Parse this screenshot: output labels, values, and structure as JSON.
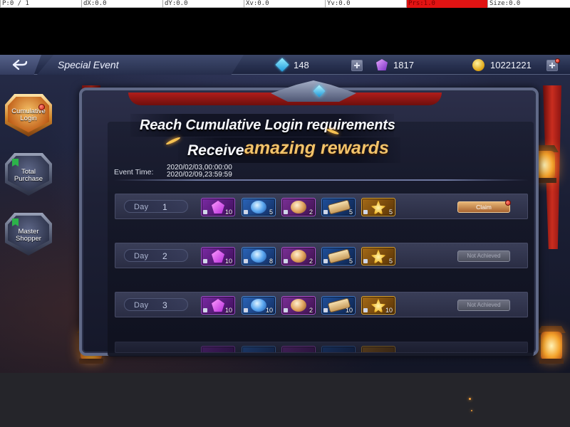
{
  "debug_bar": {
    "cells": [
      {
        "text": "P:0 / 1",
        "hot": false
      },
      {
        "text": "dX:0.0",
        "hot": false
      },
      {
        "text": "dY:0.0",
        "hot": false
      },
      {
        "text": "Xv:0.0",
        "hot": false
      },
      {
        "text": "Yv:0.0",
        "hot": false
      },
      {
        "text": "Prs:1.0",
        "hot": true
      },
      {
        "text": "Size:0.0",
        "hot": false
      }
    ]
  },
  "header": {
    "title": "Special Event",
    "diamonds": "148",
    "crystals": "1817",
    "gold": "10221221"
  },
  "tabs": [
    {
      "label": "Cumulative Login",
      "active": true,
      "badge": true
    },
    {
      "label": "Total Purchase",
      "active": false,
      "badge": false
    },
    {
      "label": "Master Shopper",
      "active": false,
      "badge": false
    }
  ],
  "banner": {
    "headline": "Reach Cumulative Login requirements",
    "subline_prefix": "Receive",
    "subline_highlight": "amazing rewards"
  },
  "event_time": {
    "label": "Event Time:",
    "start": "2020/02/03,00:00:00",
    "end": "2020/02/09,23:59:59"
  },
  "days": [
    {
      "label": "Day",
      "num": "1",
      "status": "Claim",
      "claimable": true,
      "rewards": [
        {
          "icon": "purple-gem-icon",
          "style": "purple",
          "qty": "10"
        },
        {
          "icon": "blue-orb-icon",
          "style": "blue",
          "qty": "5"
        },
        {
          "icon": "gold-orb-icon",
          "style": "violet",
          "qty": "2"
        },
        {
          "icon": "scroll-icon",
          "style": "navy",
          "qty": "5"
        },
        {
          "icon": "gold-burst-icon",
          "style": "gold",
          "qty": "5"
        }
      ]
    },
    {
      "label": "Day",
      "num": "2",
      "status": "Not Achieved",
      "claimable": false,
      "rewards": [
        {
          "icon": "purple-gem-icon",
          "style": "purple",
          "qty": "10"
        },
        {
          "icon": "blue-orb-icon",
          "style": "blue",
          "qty": "8"
        },
        {
          "icon": "gold-orb-icon",
          "style": "violet",
          "qty": "2"
        },
        {
          "icon": "scroll-icon",
          "style": "navy",
          "qty": "5"
        },
        {
          "icon": "gold-burst-icon",
          "style": "gold",
          "qty": "5"
        }
      ]
    },
    {
      "label": "Day",
      "num": "3",
      "status": "Not Achieved",
      "claimable": false,
      "rewards": [
        {
          "icon": "purple-gem-icon",
          "style": "purple",
          "qty": "10"
        },
        {
          "icon": "blue-orb-icon",
          "style": "blue",
          "qty": "10"
        },
        {
          "icon": "gold-orb-icon",
          "style": "violet",
          "qty": "2"
        },
        {
          "icon": "scroll-icon",
          "style": "navy",
          "qty": "10"
        },
        {
          "icon": "gold-burst-icon",
          "style": "gold",
          "qty": "10"
        }
      ]
    }
  ],
  "colors": {
    "accent_gold": "#f2c36a",
    "claim_button": "#c98a4f",
    "badge_red": "#d01d10"
  }
}
